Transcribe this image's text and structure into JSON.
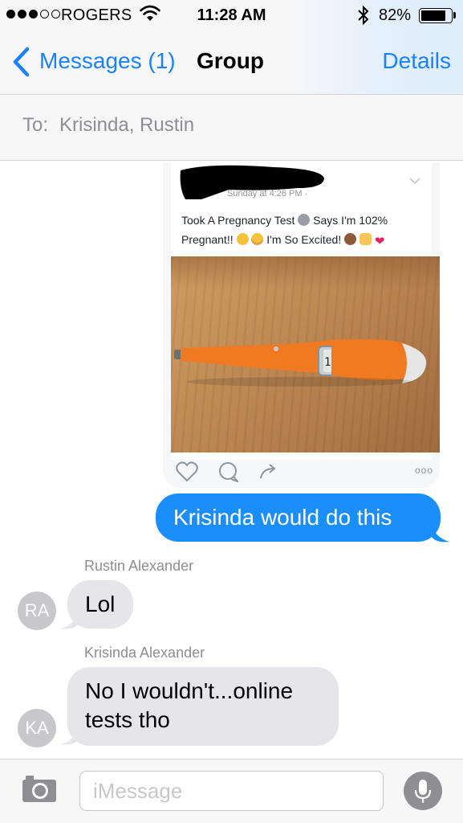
{
  "status_bar": {
    "carrier": "ROGERS",
    "time": "11:28 AM",
    "battery_percent": "82%",
    "battery_level": 0.82,
    "signal_bars_filled": 3,
    "signal_bars_total": 5
  },
  "nav": {
    "back_label": "Messages (1)",
    "title": "Group",
    "details_label": "Details",
    "accent_color": "#1a82fb"
  },
  "recipients": {
    "label": "To:",
    "names": "Krisinda, Rustin"
  },
  "shared_image": {
    "post_time": "Sunday at 4:26 PM · ",
    "post_text_line1": "Took A Pregnancy Test",
    "post_text_line1_tail": "Says I'm 102%",
    "post_text_line2": "Pregnant!!",
    "post_text_line2_tail": "I'm So Excited!",
    "thermometer_display": "102.8°F",
    "more_label": "ooo"
  },
  "messages": [
    {
      "direction": "outgoing",
      "text": "Krisinda would do this"
    },
    {
      "direction": "incoming",
      "sender": "Rustin Alexander",
      "initials": "RA",
      "text": "Lol"
    },
    {
      "direction": "incoming",
      "sender": "Krisinda Alexander",
      "initials": "KA",
      "text_line1": "No I wouldn't...online",
      "text_line2": "tests tho"
    }
  ],
  "input": {
    "placeholder": "iMessage"
  },
  "colors": {
    "outgoing_bubble": "#1a8ffb",
    "incoming_bubble": "#e5e5ea",
    "avatar": "#c7c7cc",
    "thermometer": "#f07a22"
  }
}
